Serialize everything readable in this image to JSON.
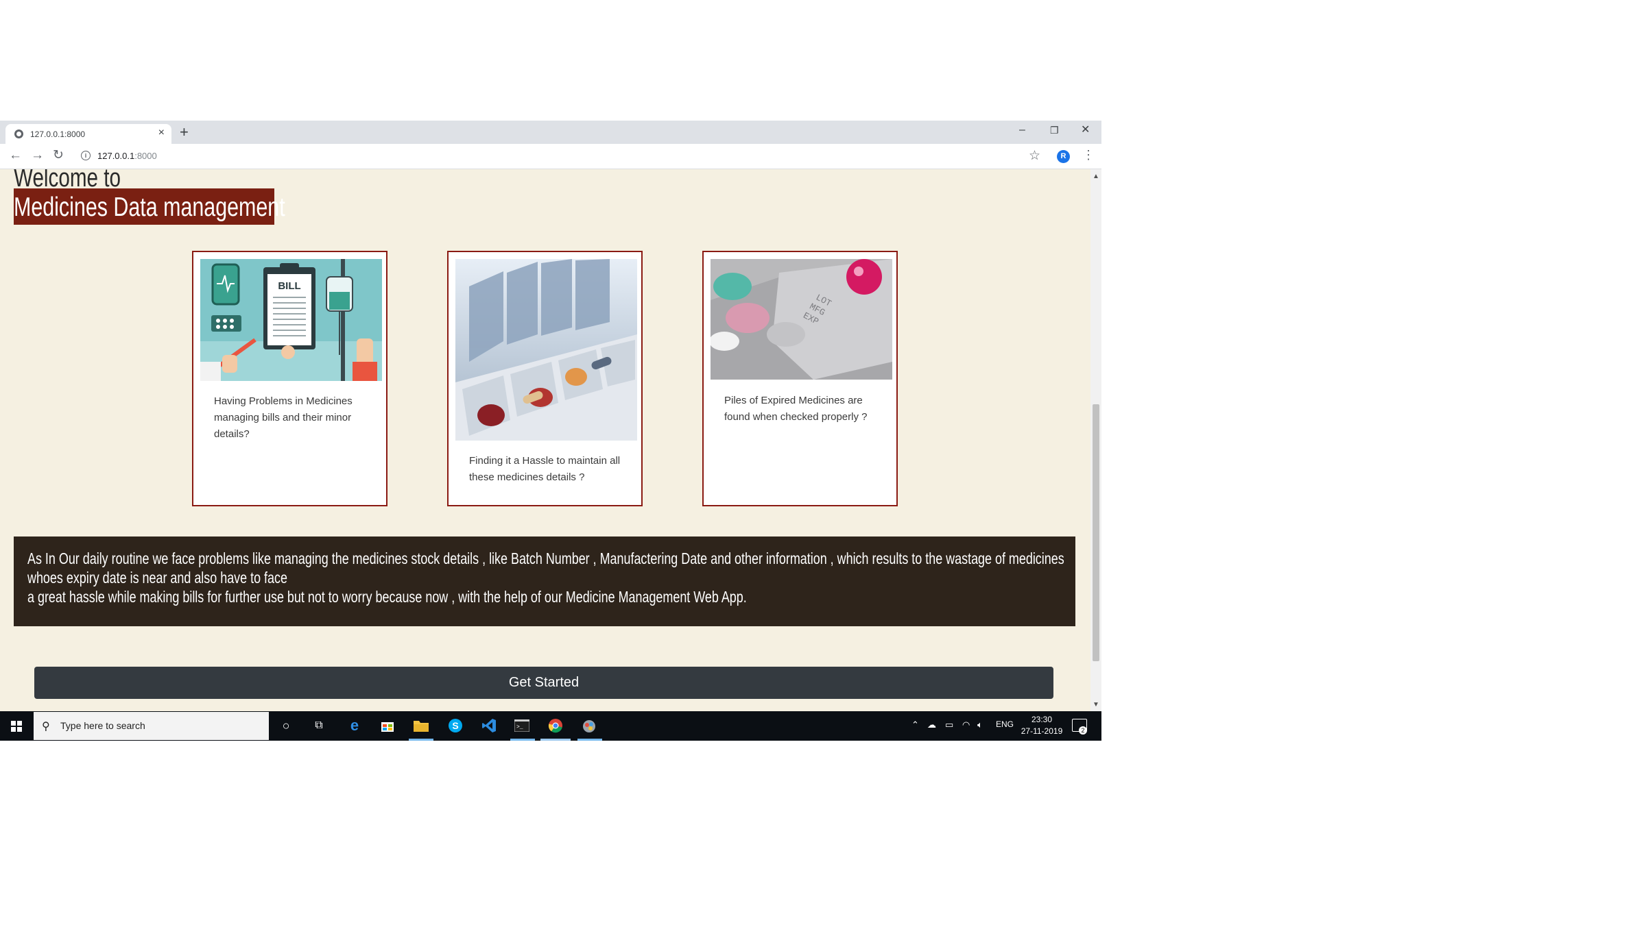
{
  "browser": {
    "tab_title": "127.0.0.1:8000",
    "tab_close": "×",
    "new_tab": "+",
    "url_host": "127.0.0.1",
    "url_port": ":8000",
    "profile_initial": "R",
    "window_controls": {
      "minimize": "–",
      "restore": "❐",
      "close": "✕"
    }
  },
  "page": {
    "welcome": "Welcome to",
    "title": "Medicines Data management",
    "cards": [
      {
        "caption": "Having Problems in Medicines managing bills and their minor details?",
        "image": "medical-bill-illustration"
      },
      {
        "caption": "Finding it a Hassle to maintain all these medicines details ?",
        "image": "pill-organizer-photo"
      },
      {
        "caption": "Piles of Expired Medicines are found when checked properly ?",
        "image": "expired-blister-pack-photo",
        "image_text": [
          "LOT",
          "MFG",
          "EXP"
        ]
      }
    ],
    "info_lines": [
      "As In Our daily routine we face problems like managing the medicines stock details , like Batch Number , Manufactering Date and other information , which results to the wastage of medicines",
      "whoes expiry date is near and also have to face",
      "a great hassle while making bills for further use but not to worry because now , with the help of our Medicine Management Web App."
    ],
    "cta": "Get Started"
  },
  "bill_text": "BILL",
  "taskbar": {
    "search_placeholder": "Type here to search",
    "language": "ENG",
    "time": "23:30",
    "date": "27-11-2019",
    "notification_count": "2"
  },
  "colors": {
    "page_bg": "#f5f0e1",
    "title_bg": "#7a2012",
    "card_border": "#8a1a12",
    "info_bg": "#2e241b",
    "button_bg": "#343a40"
  }
}
